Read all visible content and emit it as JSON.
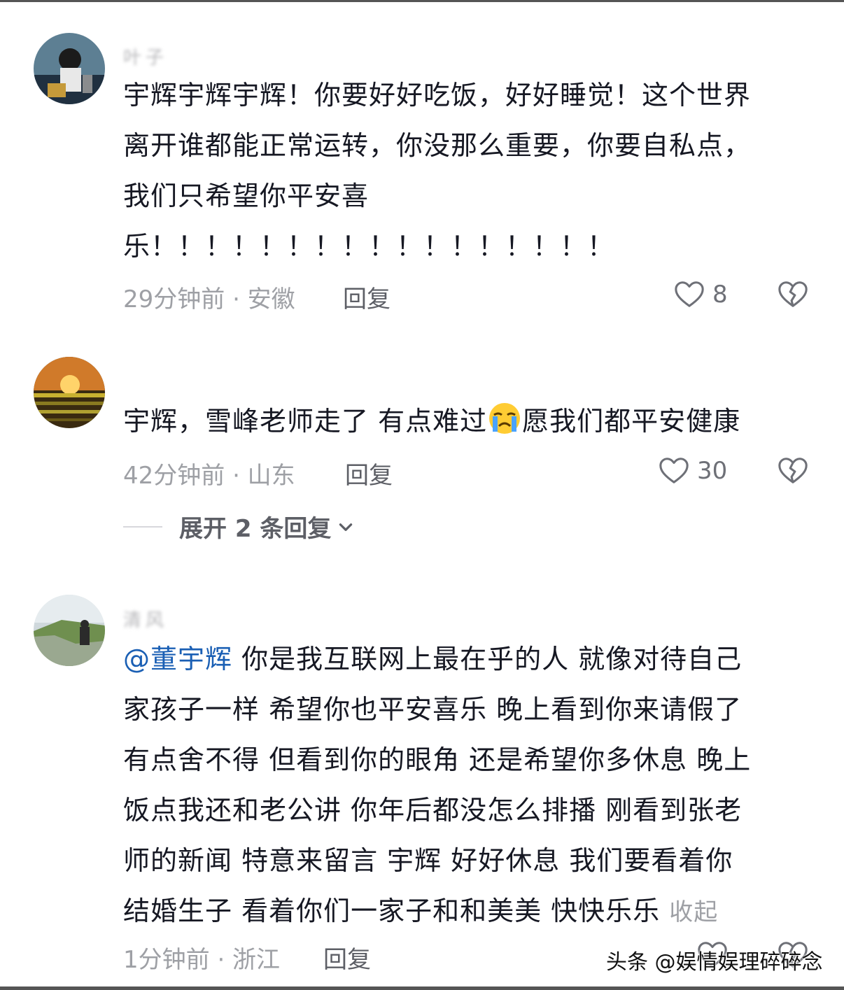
{
  "comments": [
    {
      "username": "叶子",
      "text_lines": [
        "宇辉宇辉宇辉！你要好好吃饭，好好睡觉！这个世界",
        "离开谁都能正常运转，你没那么重要，你要自私点，",
        "我们只希望你平安喜",
        "乐！！！！！！！！！！！！！！！！！"
      ],
      "time_location": "29分钟前 · 安徽",
      "reply_label": "回复",
      "like_count": "8"
    },
    {
      "text_before_emoji": "宇辉，雪峰老师走了 有点难过",
      "emoji": "crying-face",
      "text_after_emoji": "愿我们都平安健康",
      "time_location": "42分钟前 · 山东",
      "reply_label": "回复",
      "like_count": "30",
      "expand_label": "展开 2 条回复"
    },
    {
      "username": "清风",
      "mention": "@董宇辉",
      "text_lines": [
        " 你是我互联网上最在乎的人 就像对待自己",
        "家孩子一样 希望你也平安喜乐 晚上看到你来请假了",
        "有点舍不得 但看到你的眼角 还是希望你多休息 晚上",
        "饭点我还和老公讲 你年后都没怎么排播  刚看到张老",
        "师的新闻 特意来留言 宇辉 好好休息 我们要看着你",
        "结婚生子 看着你们一家子和和美美 快快乐乐 "
      ],
      "collapse_label": "收起",
      "time_location": "1分钟前 · 浙江",
      "reply_label": "回复"
    }
  ],
  "watermark": "头条 @娱情娱理碎碎念",
  "colors": {
    "text": "#161823",
    "meta": "#9ea0a5",
    "mention": "#1a5fb4"
  }
}
